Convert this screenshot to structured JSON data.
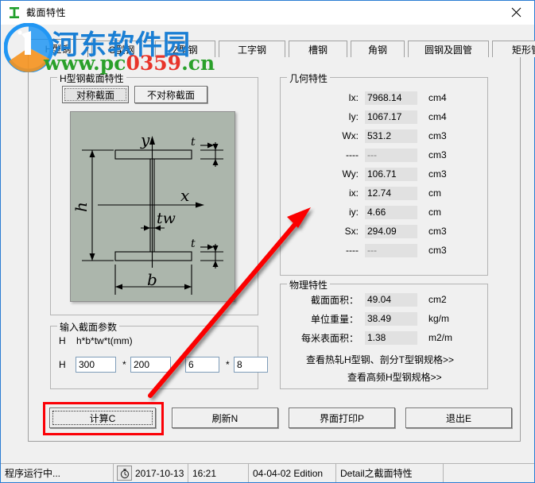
{
  "window": {
    "title": "截面特性",
    "icon": "ibeam-icon",
    "close_label": "✕"
  },
  "watermark": {
    "site_name": "河东软件园",
    "url_prefix": "www.",
    "url_mid": "pc",
    "url_num": "0359",
    "url_suffix": ".cn",
    "brand_color": "#1a7fd4",
    "url_color": "#2aa02a",
    "url_accent": "#e8342a"
  },
  "tabs": [
    {
      "label": "H型钢",
      "selected": true
    },
    {
      "label": "C型钢",
      "selected": false
    },
    {
      "label": "Z型钢",
      "selected": false
    },
    {
      "label": "工字钢",
      "selected": false
    },
    {
      "label": "槽钢",
      "selected": false
    },
    {
      "label": "角钢",
      "selected": false
    },
    {
      "label": "圆钢及圆管",
      "selected": false
    },
    {
      "label": "矩形管",
      "selected": false
    }
  ],
  "section_group": {
    "legend": "H型钢截面特性",
    "symmetric_button": "对称截面",
    "asymmetric_button": "不对称截面"
  },
  "diagram": {
    "axis_y": "y",
    "axis_x": "x",
    "height_label": "h",
    "width_label": "b",
    "web_label": "tw",
    "flange_top_label": "t",
    "flange_bottom_label": "t"
  },
  "input_group": {
    "legend": "输入截面参数",
    "format_prefix": "H",
    "format_hint": "h*b*tw*t(mm)",
    "row_prefix": "H",
    "sep": "*",
    "fields": [
      {
        "name": "h",
        "value": "300"
      },
      {
        "name": "b",
        "value": "200"
      },
      {
        "name": "tw",
        "value": "6"
      },
      {
        "name": "t",
        "value": "8"
      }
    ]
  },
  "geometry_group": {
    "legend": "几何特性",
    "rows": [
      {
        "label": "Ix:",
        "value": "7968.14",
        "unit": "cm4",
        "dim": false
      },
      {
        "label": "Iy:",
        "value": "1067.17",
        "unit": "cm4",
        "dim": false
      },
      {
        "label": "Wx:",
        "value": "531.2",
        "unit": "cm3",
        "dim": false
      },
      {
        "label": "----",
        "value": "---",
        "unit": "cm3",
        "dim": true
      },
      {
        "label": "Wy:",
        "value": "106.71",
        "unit": "cm3",
        "dim": false
      },
      {
        "label": "ix:",
        "value": "12.74",
        "unit": "cm",
        "dim": false
      },
      {
        "label": "iy:",
        "value": "4.66",
        "unit": "cm",
        "dim": false
      },
      {
        "label": "Sx:",
        "value": "294.09",
        "unit": "cm3",
        "dim": false
      },
      {
        "label": "----",
        "value": "---",
        "unit": "cm3",
        "dim": true
      }
    ]
  },
  "physical_group": {
    "legend": "物理特性",
    "rows": [
      {
        "label": "截面面积：",
        "value": "49.04",
        "unit": "cm2"
      },
      {
        "label": "单位重量：",
        "value": "38.49",
        "unit": "kg/m"
      },
      {
        "label": "每米表面积：",
        "value": "1.38",
        "unit": "m2/m"
      }
    ],
    "links": [
      "查看热轧H型钢、剖分T型钢规格>>",
      "查看高频H型钢规格>>"
    ]
  },
  "bottom_buttons": [
    {
      "label": "计算C",
      "focused": true
    },
    {
      "label": "刷新N",
      "focused": false
    },
    {
      "label": "界面打印P",
      "focused": false
    },
    {
      "label": "退出E",
      "focused": false
    }
  ],
  "statusbar": {
    "running": "程序运行中...",
    "clock_icon": "stopwatch-icon",
    "date": "2017-10-13",
    "time": "16:21",
    "edition": "04-04-02 Edition",
    "module": "Detail之截面特性",
    "spare": ""
  },
  "annotations": {
    "highlight_color": "#fb0006",
    "arrow_from": "计算C",
    "arrow_to": "几何特性"
  }
}
